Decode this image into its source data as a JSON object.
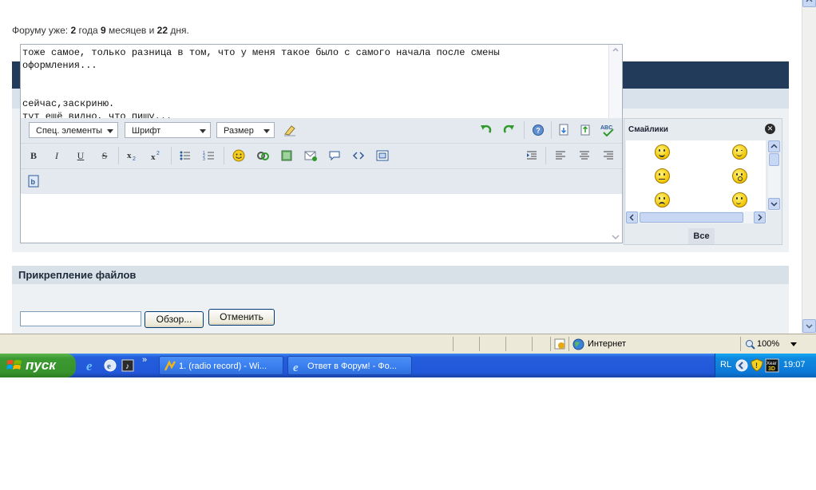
{
  "forum_age": {
    "prefix": "Форуму уже:",
    "years_num": "2",
    "years_word": "года",
    "months_num": "9",
    "months_word": "месяцев и",
    "days_num": "22",
    "days_word": "дня."
  },
  "editor": {
    "text": "тоже самое, только разница в том, что у меня такое было с самого начала после смены\nоформления...\n\n\nсейчас,заскриню.\nтут ещё видно, что пишу...",
    "dropdowns": {
      "special": "Спец. элементы",
      "font": "Шрифт",
      "size": "Размер"
    },
    "format": {
      "bold": "B",
      "italic": "I",
      "underline": "U",
      "strike": "S"
    }
  },
  "smilies": {
    "title": "Смайлики",
    "all_label": "Все"
  },
  "attachments": {
    "title": "Прикрепление файлов",
    "browse_label": "Обзор...",
    "cancel_label": "Отменить"
  },
  "ie_status": {
    "zone": "Интернет",
    "zoom": "100%"
  },
  "taskbar": {
    "start_label": "пуск",
    "tasks": [
      {
        "label": "1.  (radio record) - Wi..."
      },
      {
        "label": "Ответ в Форум! - Фо..."
      }
    ],
    "lang": "RL",
    "clock": "19:07"
  },
  "colors": {
    "header_dark": "#223b5a",
    "taskbar_blue": "#245edb",
    "start_green": "#3c9a32"
  }
}
